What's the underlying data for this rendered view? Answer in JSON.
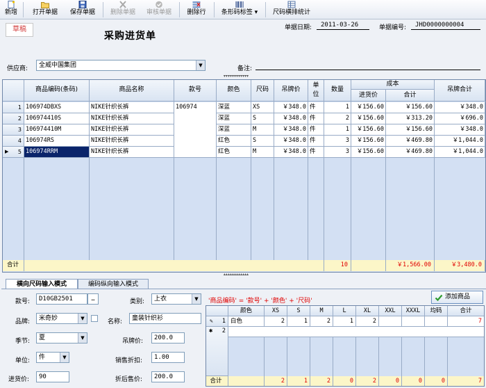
{
  "toolbar": {
    "new": "新增",
    "open": "打开单据",
    "save": "保存单据",
    "delete": "删除单据",
    "review": "审核单据",
    "delete_row": "删除行",
    "barcode": "条形码标签",
    "stats": "尺码横排统计"
  },
  "header": {
    "status": "草稿",
    "title": "采购进货单",
    "date_label": "单据日期:",
    "date_value": "2011-03-26",
    "number_label": "单据编号:",
    "number_value": "JHD0000000004",
    "supplier_label": "供应商:",
    "supplier_value": "全威中国集团",
    "remark_label": "备注:"
  },
  "grid": {
    "headers": {
      "code": "商品编码(条码)",
      "name": "商品名称",
      "style": "款号",
      "color": "颜色",
      "size": "尺码",
      "tag_price": "吊牌价",
      "unit_top": "单",
      "unit_bottom": "位",
      "qty": "数量",
      "cost": "成本",
      "purchase_price": "进货价",
      "total": "合计",
      "tag_total": "吊牌合计"
    },
    "rows": [
      {
        "no": "1",
        "code": "106974DBXS",
        "name": "NIKE针织长裤",
        "style": "106974",
        "color": "深蓝",
        "size": "XS",
        "tag_price": "￥348.0",
        "unit": "件",
        "qty": "1",
        "purchase_price": "￥156.60",
        "total": "￥156.60",
        "tag_total": "￥348.0"
      },
      {
        "no": "2",
        "code": "106974410S",
        "name": "NIKE针织长裤",
        "style": "",
        "color": "深蓝",
        "size": "S",
        "tag_price": "￥348.0",
        "unit": "件",
        "qty": "2",
        "purchase_price": "￥156.60",
        "total": "￥313.20",
        "tag_total": "￥696.0"
      },
      {
        "no": "3",
        "code": "106974410M",
        "name": "NIKE针织长裤",
        "style": "",
        "color": "深蓝",
        "size": "M",
        "tag_price": "￥348.0",
        "unit": "件",
        "qty": "1",
        "purchase_price": "￥156.60",
        "total": "￥156.60",
        "tag_total": "￥348.0"
      },
      {
        "no": "4",
        "code": "106974RS",
        "name": "NIKE针织长裤",
        "style": "",
        "color": "红色",
        "size": "S",
        "tag_price": "￥348.0",
        "unit": "件",
        "qty": "3",
        "purchase_price": "￥156.60",
        "total": "￥469.80",
        "tag_total": "￥1,044.0"
      },
      {
        "no": "5",
        "code": "106974RRM",
        "name": "NIKE针织长裤",
        "style": "",
        "color": "红色",
        "size": "M",
        "tag_price": "￥348.0",
        "unit": "件",
        "qty": "3",
        "purchase_price": "￥156.60",
        "total": "￥469.80",
        "tag_total": "￥1,044.0"
      }
    ],
    "totals_label": "合计",
    "total_qty": "10",
    "total_cost": "￥1,566.00",
    "total_tag": "￥3,480.0"
  },
  "tabs": {
    "horizontal": "横向尺码输入模式",
    "vertical": "编码纵向输入模式"
  },
  "form": {
    "style_label": "款号:",
    "style_value": "D10GB2501",
    "category_label": "类别:",
    "category_value": "上衣",
    "brand_label": "品牌:",
    "brand_value": "米奇妙",
    "name_label": "名称:",
    "name_value": "童装针织衫",
    "season_label": "季节:",
    "season_value": "夏",
    "tag_price_label": "吊牌价:",
    "tag_price_value": "200.0",
    "unit_label": "单位:",
    "unit_value": "件",
    "discount_label": "销售折扣:",
    "discount_value": "1.00",
    "cost_label": "进货价:",
    "cost_value": "90",
    "sale_price_label": "折后售价:",
    "sale_price_value": "200.0",
    "hint": "'商品编码' = '款号' + '颜色' + '尺码'",
    "add_button": "添加商品"
  },
  "size_grid": {
    "headers": [
      "颜色",
      "XS",
      "S",
      "M",
      "L",
      "XL",
      "XXL",
      "XXXL",
      "均码",
      "合计"
    ],
    "rows": [
      {
        "no": "1",
        "cells": [
          "白色",
          "2",
          "1",
          "2",
          "1",
          "2",
          "",
          "",
          "",
          "7"
        ]
      },
      {
        "no": "2",
        "cells": [
          "",
          "",
          "",
          "",
          "",
          "",
          "",
          "",
          "",
          ""
        ]
      }
    ],
    "totals_label": "合计",
    "totals": [
      "2",
      "1",
      "2",
      "0",
      "2",
      "0",
      "0",
      "0",
      "7"
    ]
  },
  "colors": {
    "accent_red": "#e00000",
    "selection": "#0a246a",
    "total_row": "#fcf6c8"
  }
}
